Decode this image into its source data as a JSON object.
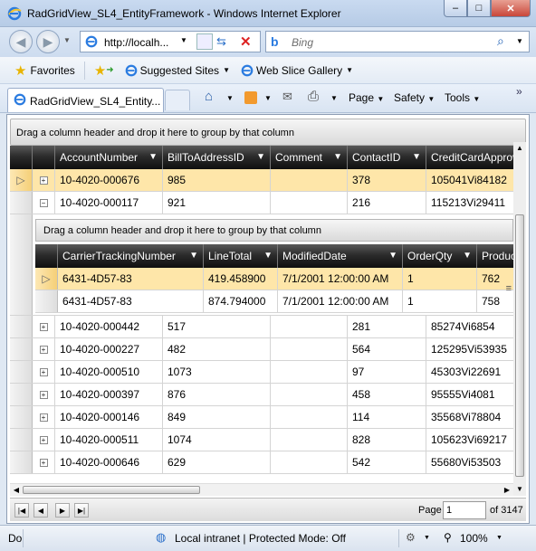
{
  "window": {
    "title": "RadGridView_SL4_EntityFramework - Windows Internet Explorer",
    "minimize_glyph": "–",
    "maximize_glyph": "□",
    "close_glyph": "✕"
  },
  "navigation": {
    "address": "http://localh...",
    "search_placeholder": "Bing"
  },
  "favorites_bar": {
    "favorites_label": "Favorites",
    "suggested_sites_label": "Suggested Sites",
    "web_slice_label": "Web Slice Gallery"
  },
  "tabs": [
    {
      "label": "RadGridView_SL4_Entity..."
    }
  ],
  "command_bar": {
    "page": "Page",
    "safety": "Safety",
    "tools": "Tools"
  },
  "grid": {
    "group_panel_text": "Drag a column header and drop it here to group by that column",
    "columns": [
      "AccountNumber",
      "BillToAddressID",
      "Comment",
      "ContactID",
      "CreditCardApprovalCode"
    ],
    "rows": [
      {
        "account": "10-4020-000676",
        "billto": "985",
        "comment": "",
        "contact": "378",
        "cc": "105041Vi84182",
        "expand": "+",
        "selected": true
      },
      {
        "account": "10-4020-000117",
        "billto": "921",
        "comment": "",
        "contact": "216",
        "cc": "115213Vi29411",
        "expand": "−",
        "selected": false
      }
    ],
    "detail": {
      "group_panel_text": "Drag a column header and drop it here to group by that column",
      "columns": [
        "CarrierTrackingNumber",
        "LineTotal",
        "ModifiedDate",
        "OrderQty",
        "ProductID"
      ],
      "rows": [
        {
          "tracking": "6431-4D57-83",
          "linetotal": "419.458900",
          "modified": "7/1/2001 12:00:00 AM",
          "qty": "1",
          "product": "762",
          "selected": true
        },
        {
          "tracking": "6431-4D57-83",
          "linetotal": "874.794000",
          "modified": "7/1/2001 12:00:00 AM",
          "qty": "1",
          "product": "758",
          "selected": false
        }
      ]
    },
    "more_rows": [
      {
        "account": "10-4020-000442",
        "billto": "517",
        "contact": "281",
        "cc": "85274Vi6854"
      },
      {
        "account": "10-4020-000227",
        "billto": "482",
        "contact": "564",
        "cc": "125295Vi53935"
      },
      {
        "account": "10-4020-000510",
        "billto": "1073",
        "contact": "97",
        "cc": "45303Vi22691"
      },
      {
        "account": "10-4020-000397",
        "billto": "876",
        "contact": "458",
        "cc": "95555Vi4081"
      },
      {
        "account": "10-4020-000146",
        "billto": "849",
        "contact": "114",
        "cc": "35568Vi78804"
      },
      {
        "account": "10-4020-000511",
        "billto": "1074",
        "contact": "828",
        "cc": "105623Vi69217"
      },
      {
        "account": "10-4020-000646",
        "billto": "629",
        "contact": "542",
        "cc": "55680Vi53503"
      }
    ],
    "pager": {
      "page_label": "Page",
      "page_value": "1",
      "of_label": "of 3147"
    }
  },
  "status": {
    "left": "Do",
    "zone": "Local intranet | Protected Mode: Off",
    "zoom": "100%"
  },
  "colors": {
    "selected_row": "#fee6a9",
    "header_dark": "#1a1a1a",
    "ie_blue": "#1e6fd0"
  }
}
